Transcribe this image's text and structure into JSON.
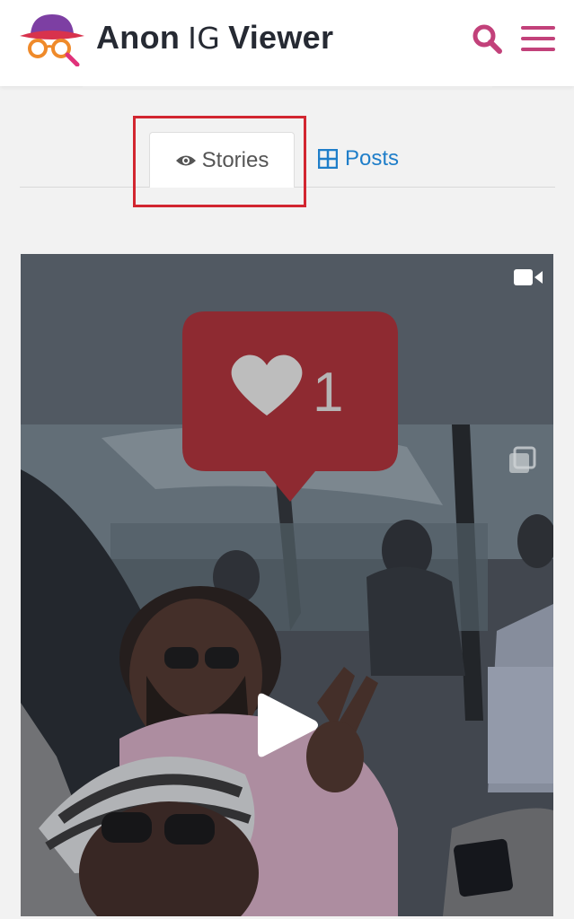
{
  "brand": {
    "part1": "Anon",
    "part2": "IG",
    "part3": "Viewer",
    "accent_color": "#c2417a",
    "logo_icon": "spy-hat-glasses-icon"
  },
  "header": {
    "search_icon": "search-icon",
    "menu_icon": "hamburger-menu-icon"
  },
  "tabs": {
    "stories": {
      "label": "Stories",
      "icon": "eye-icon",
      "active": true
    },
    "posts": {
      "label": "Posts",
      "icon": "grid-icon",
      "active": false
    }
  },
  "story": {
    "media_type_icon": "video-camera-icon",
    "multi_icon": "multiple-media-icon",
    "overlay_like_count": "1",
    "play_icon": "play-icon"
  }
}
